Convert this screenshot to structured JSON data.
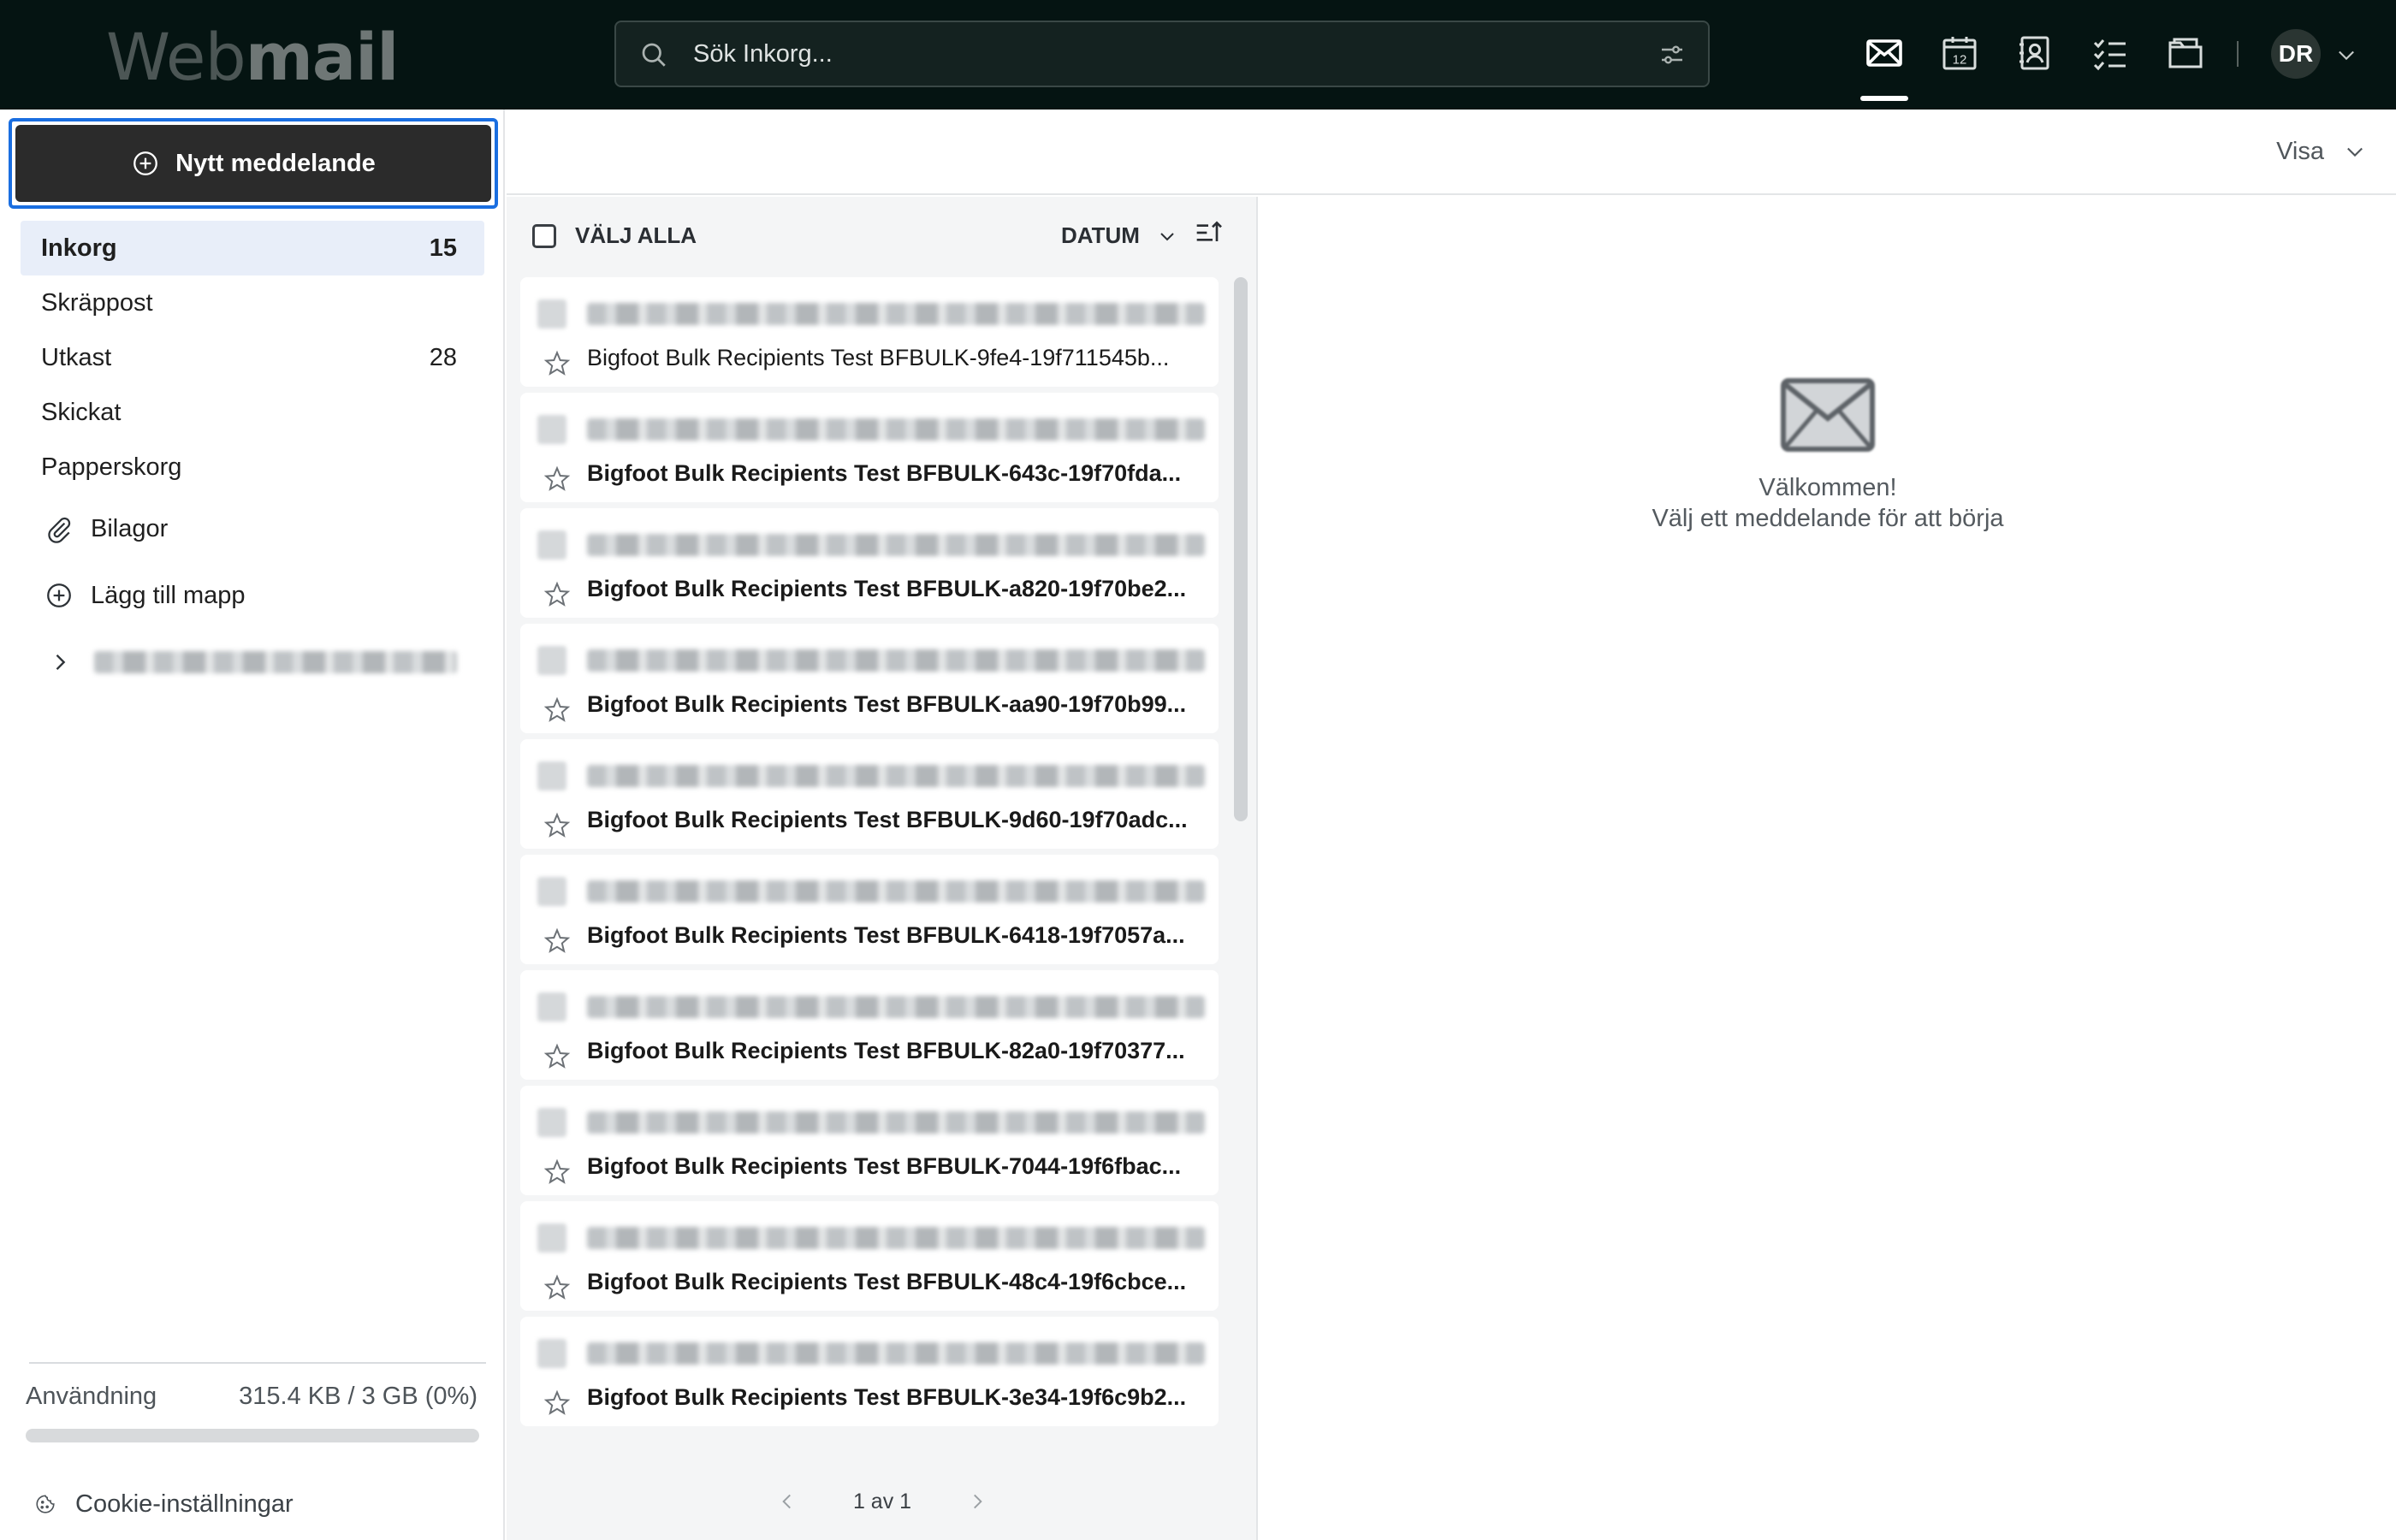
{
  "app": {
    "logo_regular": "Web",
    "logo_bold": "mail"
  },
  "search": {
    "placeholder": "Sök Inkorg..."
  },
  "user": {
    "initials": "DR"
  },
  "compose": {
    "label": "Nytt meddelande"
  },
  "folders": [
    {
      "name": "Inkorg",
      "count": "15",
      "active": true
    },
    {
      "name": "Skräppost",
      "count": ""
    },
    {
      "name": "Utkast",
      "count": "28"
    },
    {
      "name": "Skickat",
      "count": ""
    },
    {
      "name": "Papperskorg",
      "count": ""
    }
  ],
  "sidebar": {
    "attachments_label": "Bilagor",
    "add_folder_label": "Lägg till mapp",
    "usage_label": "Användning",
    "usage_value": "315.4 KB / 3 GB (0%)",
    "usage_fraction": 0.0,
    "cookie_label": "Cookie-inställningar"
  },
  "view": {
    "visa_label": "Visa"
  },
  "list": {
    "select_all_label": "VÄLJ ALLA",
    "sort_label": "DATUM",
    "pager_text": "1 av 1",
    "messages": [
      {
        "subject": "Bigfoot Bulk Recipients Test BFBULK-9fe4-19f711545b...",
        "unread": false
      },
      {
        "subject": "Bigfoot Bulk Recipients Test BFBULK-643c-19f70fda...",
        "unread": true
      },
      {
        "subject": "Bigfoot Bulk Recipients Test BFBULK-a820-19f70be2...",
        "unread": true
      },
      {
        "subject": "Bigfoot Bulk Recipients Test BFBULK-aa90-19f70b99...",
        "unread": true
      },
      {
        "subject": "Bigfoot Bulk Recipients Test BFBULK-9d60-19f70adc...",
        "unread": true
      },
      {
        "subject": "Bigfoot Bulk Recipients Test BFBULK-6418-19f7057a...",
        "unread": true
      },
      {
        "subject": "Bigfoot Bulk Recipients Test BFBULK-82a0-19f70377...",
        "unread": true
      },
      {
        "subject": "Bigfoot Bulk Recipients Test BFBULK-7044-19f6fbac...",
        "unread": true
      },
      {
        "subject": "Bigfoot Bulk Recipients Test BFBULK-48c4-19f6cbce...",
        "unread": true
      },
      {
        "subject": "Bigfoot Bulk Recipients Test BFBULK-3e34-19f6c9b2...",
        "unread": true
      }
    ]
  },
  "reading_pane": {
    "welcome_title": "Välkommen!",
    "welcome_subtitle": "Välj ett meddelande för att börja"
  },
  "colors": {
    "topbar_bg": "#051412",
    "compose_bg": "#2b2b2b",
    "focus_ring": "#1a6ee0",
    "active_folder_bg": "#e8eef9",
    "list_bg": "#f4f5f6"
  },
  "icons": {
    "top_nav": [
      "mail-icon",
      "calendar-icon",
      "contacts-icon",
      "tasks-icon",
      "files-icon"
    ],
    "search": "search-icon",
    "filter": "filter-sliders-icon",
    "compose": "plus-circle-icon",
    "attachments": "paperclip-icon",
    "add_folder": "plus-circle-icon",
    "account_expand": "chevron-right-icon",
    "cookie": "cookie-icon",
    "star": "star-icon",
    "pager_prev": "chevron-left-icon",
    "pager_next": "chevron-right-icon",
    "welcome": "envelope-icon"
  }
}
